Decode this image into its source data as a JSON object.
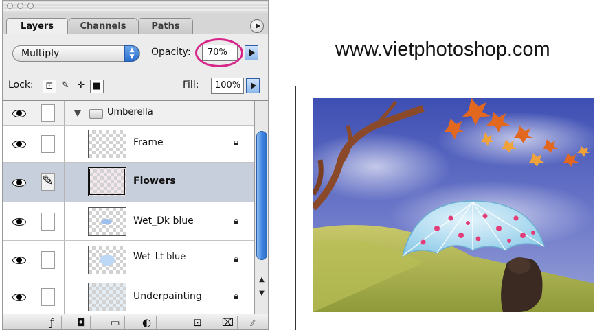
{
  "panel": {
    "tabs": [
      {
        "label": "Layers",
        "active": true
      },
      {
        "label": "Channels",
        "active": false
      },
      {
        "label": "Paths",
        "active": false
      }
    ],
    "blend_mode": "Multiply",
    "opacity_label": "Opacity:",
    "opacity_value": "70%",
    "lock_label": "Lock:",
    "fill_label": "Fill:",
    "fill_value": "100%",
    "layers": [
      {
        "name": "Umberella",
        "type": "group",
        "visible": true,
        "expanded": true
      },
      {
        "name": "Frame",
        "type": "layer",
        "visible": true,
        "locked": true,
        "selected": false
      },
      {
        "name": "Flowers",
        "type": "layer",
        "visible": true,
        "locked": false,
        "selected": true,
        "brush_link": true
      },
      {
        "name": "Wet_Dk blue",
        "type": "layer",
        "visible": true,
        "locked": true,
        "selected": false
      },
      {
        "name": "Wet_Lt blue",
        "type": "layer",
        "visible": true,
        "locked": true,
        "selected": false
      },
      {
        "name": "Underpainting",
        "type": "layer",
        "visible": true,
        "locked": true,
        "selected": false
      }
    ],
    "bottom_icons": [
      "layer-style-icon",
      "layer-mask-icon",
      "new-group-icon",
      "adjustment-layer-icon",
      "new-layer-icon",
      "trash-icon"
    ]
  },
  "site_url": "www.vietphotoshop.com",
  "colors": {
    "accent_blue": "#3d84e0",
    "highlight_oval": "#d6268a",
    "selected_row": "#c7cfdd"
  }
}
